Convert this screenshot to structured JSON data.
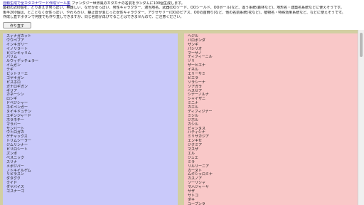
{
  "header": {
    "title_link": "自動生成で全カタカナワード作成ツール集",
    "title_rest": " ファンタジー世界風のカタカナの名前をランダムに100個生成します。",
    "line2": "最初の200個を、とりあえず男っぽい、無難しい、なぜか女っぽい、男性キャラクター、適当地名、武器(OOソード、OOシールド、OOボール)など、違う系統(森林など)、地形名・建築名系統などに使えそうです。",
    "line3": "後半200個は、とことなく女性っぽい、やわらかい、静止音が混じった女性キャラクター、アクセサリー(OOのピアス、OOの首飾り)など、他の名前系統(花など)、植物名・特殊効果系統など、などに使えそうです。",
    "line4": "作成し直すボタンで何度でも作り直しできますが、同じ名前が再びでることはできませんので、ご注意ください。"
  },
  "button": {
    "label": "作り直す"
  },
  "left_names": [
    "スィナガカット",
    "ウウペブア",
    "インキガリー",
    "イノリラート",
    "ビジンキャリム",
    "パリム",
    "ルウィデッチェラー",
    "イムガン",
    "テギ",
    "ピットリーエ",
    "ゴヤキガン",
    "ピスホロ",
    "ガナロギガン",
    "ギリア",
    "カネーシン",
    "ロシギ",
    "ドベジシャー",
    "ネギペンガー",
    "ヌイキドュチン",
    "エギンジャード",
    "ホラネチー",
    "マラバー",
    "サンバート",
    "ウトロガカ",
    "ゲチャックス",
    "トリムシーラー",
    "ジムリンナー",
    "ビリロシート",
    "ズンボ",
    "ベスニック",
    "スリナ",
    "メボジバー",
    "ノトキイルゲム",
    "リピラスン",
    "ダタグク",
    "クイド",
    "ダヤバイス",
    "ゴスナーゴ"
  ],
  "right_names": [
    "ヘジル",
    "バロボンダ",
    "ザンギ",
    "パシリオ",
    "マーサノ",
    "ティフィーニル",
    "ゾリ",
    "ザーヒエナ",
    "イネル",
    "エリーサミ",
    "ビエラ",
    "ソラシーナ",
    "ソアガラ",
    "ヘスセア",
    "シナーノルナ",
    "シャイザニ",
    "ミニナ",
    "カエル",
    "ディフィジナー",
    "ミシル",
    "ジホル",
    "カシル",
    "ビャンヌス",
    "ハティシナ",
    "ミリサカジア",
    "エンキセ",
    "ジクミア",
    "マスザ",
    "エル",
    "ジュエ",
    "ミラ",
    "リルリーニア",
    "カーヌト",
    "ムギシッロミナ",
    "カスノア",
    "ソーリシャ",
    "マハジャーヤ",
    "サザ",
    "サトコ",
    "ダキ",
    "ユーブンラ"
  ],
  "colors": {
    "left_panel": "#c9c9fa",
    "right_panel": "#f9c8c8",
    "frame": "#d2cfa2",
    "link": "#1a0dab"
  }
}
